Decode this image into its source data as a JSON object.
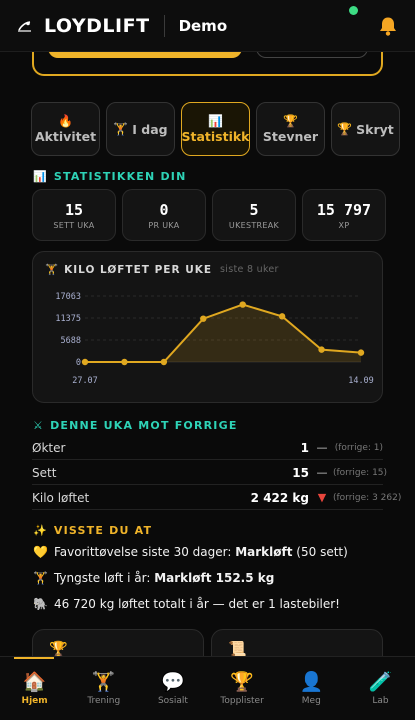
{
  "header": {
    "brand": "LOYDLIFT",
    "mode": "Demo",
    "bell_icon": "bell-icon",
    "status_color": "#3ddc84"
  },
  "tabs": [
    {
      "icon": "🔥",
      "label": "Aktivitet",
      "active": false
    },
    {
      "icon": "🏋",
      "label": "I dag",
      "active": false
    },
    {
      "icon": "📊",
      "label": "Statistikk",
      "active": true
    },
    {
      "icon": "🏆",
      "label": "Stevner",
      "active": false
    },
    {
      "icon": "🏆",
      "label": "Skryt",
      "active": false
    }
  ],
  "stats_section": {
    "icon": "📊",
    "title": "STATISTIKKEN DIN"
  },
  "stats": [
    {
      "value": "15",
      "label": "SETT UKA"
    },
    {
      "value": "0",
      "label": "PR UKA"
    },
    {
      "value": "5",
      "label": "UKESTREAK"
    },
    {
      "value": "15 797",
      "label": "XP"
    }
  ],
  "chart_card": {
    "icon": "🏋",
    "title": "KILO LØFTET PER UKE",
    "subtitle": "siste 8 uker"
  },
  "chart_data": {
    "type": "area",
    "title": "KILO LØFTET PER UKE",
    "subtitle": "siste 8 uker",
    "y_ticks": [
      0,
      5688,
      11375,
      17063
    ],
    "ylim": [
      0,
      17063
    ],
    "x_first_label": "27.07",
    "x_last_label": "14.09",
    "series": [
      {
        "values": [
          0,
          0,
          0,
          11200,
          14850,
          11800,
          3200,
          2422
        ]
      }
    ],
    "grid": true,
    "line_color": "#e0a820"
  },
  "compare_section": {
    "icon": "⚔",
    "title": "DENNE UKA MOT FORRIGE"
  },
  "compare": [
    {
      "label": "Økter",
      "value": "1",
      "trend": "—",
      "previous": "(forrige: 1)"
    },
    {
      "label": "Sett",
      "value": "15",
      "trend": "—",
      "previous": "(forrige: 15)"
    },
    {
      "label": "Kilo løftet",
      "value": "2 422 kg",
      "trend": "▼",
      "previous": "(forrige: 3 262)"
    }
  ],
  "facts_section": {
    "icon": "✨",
    "title": "VISSTE DU AT"
  },
  "facts": [
    {
      "icon": "💛",
      "prefix": "Favorittøvelse siste 30 dager: ",
      "bold": "Markløft",
      "suffix": " (50 sett)"
    },
    {
      "icon": "🏋",
      "prefix": "Tyngste løft i år: ",
      "bold": "Markløft 152.5 kg",
      "suffix": ""
    },
    {
      "icon": "🐘",
      "prefix": "46 720 kg løftet totalt i år — det er 1 lastebiler!",
      "bold": "",
      "suffix": ""
    }
  ],
  "bottom_cards": [
    {
      "icon": "🏆"
    },
    {
      "icon": "📜"
    }
  ],
  "nav": [
    {
      "icon": "🏠",
      "label": "Hjem",
      "active": true
    },
    {
      "icon": "🏋",
      "label": "Trening",
      "active": false
    },
    {
      "icon": "💬",
      "label": "Sosialt",
      "active": false
    },
    {
      "icon": "🏆",
      "label": "Topplister",
      "active": false
    },
    {
      "icon": "👤",
      "label": "Meg",
      "active": false
    },
    {
      "icon": "🧪",
      "label": "Lab",
      "active": false
    }
  ]
}
